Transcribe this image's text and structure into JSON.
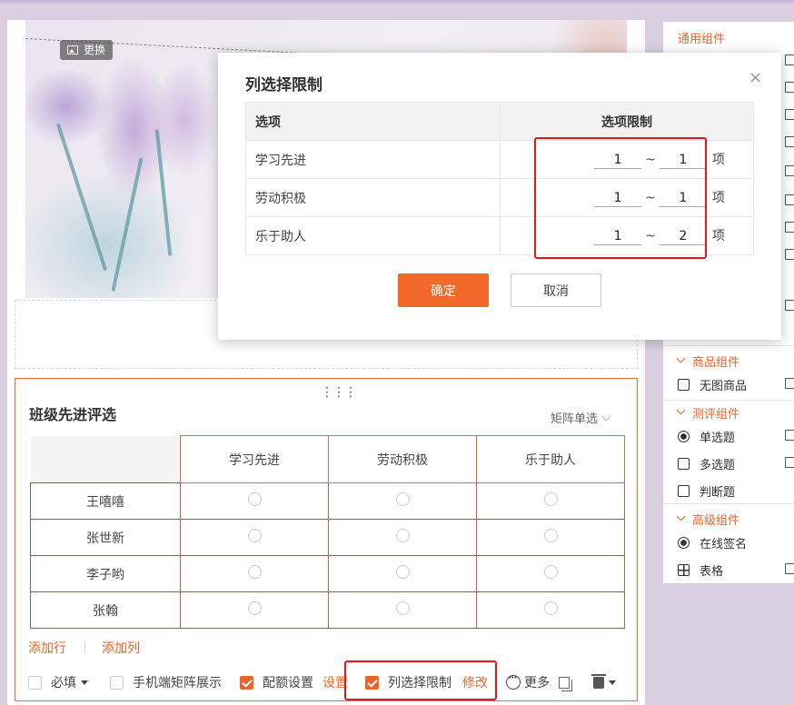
{
  "banner": {
    "replace_label": "更换"
  },
  "component": {
    "title": "班级先进评选",
    "type_label": "矩阵单选",
    "columns": [
      "学习先进",
      "劳动积极",
      "乐于助人"
    ],
    "rows": [
      "王嘻嘻",
      "张世新",
      "李子哟",
      "张翰"
    ],
    "add_row_label": "添加行",
    "add_col_label": "添加列",
    "toolbar": {
      "required_label": "必填",
      "mobile_matrix_label": "手机端矩阵展示",
      "quota_label": "配额设置",
      "quota_link": "设置",
      "col_limit_label": "列选择限制",
      "col_limit_link": "修改",
      "more_label": "更多"
    }
  },
  "panel": {
    "sections": {
      "general": "通用组件",
      "goods": "商品组件",
      "evaluation": "测评组件",
      "advanced": "高级组件"
    },
    "items": {
      "no_image_goods": "无图商品",
      "single_choice": "单选题",
      "multi_choice": "多选题",
      "judge": "判断题",
      "signature": "在线签名",
      "table": "表格"
    }
  },
  "modal": {
    "title": "列选择限制",
    "close_symbol": "×",
    "header_option": "选项",
    "header_limit": "选项限制",
    "rows": [
      {
        "option": "学习先进",
        "min": "1",
        "max": "1"
      },
      {
        "option": "劳动积极",
        "min": "1",
        "max": "1"
      },
      {
        "option": "乐于助人",
        "min": "1",
        "max": "2"
      }
    ],
    "tilde": "~",
    "unit": "项",
    "ok_label": "确定",
    "cancel_label": "取消"
  },
  "colors": {
    "accent": "#f1682b",
    "highlight": "#e21919",
    "row_border": "#4b6bbd"
  }
}
